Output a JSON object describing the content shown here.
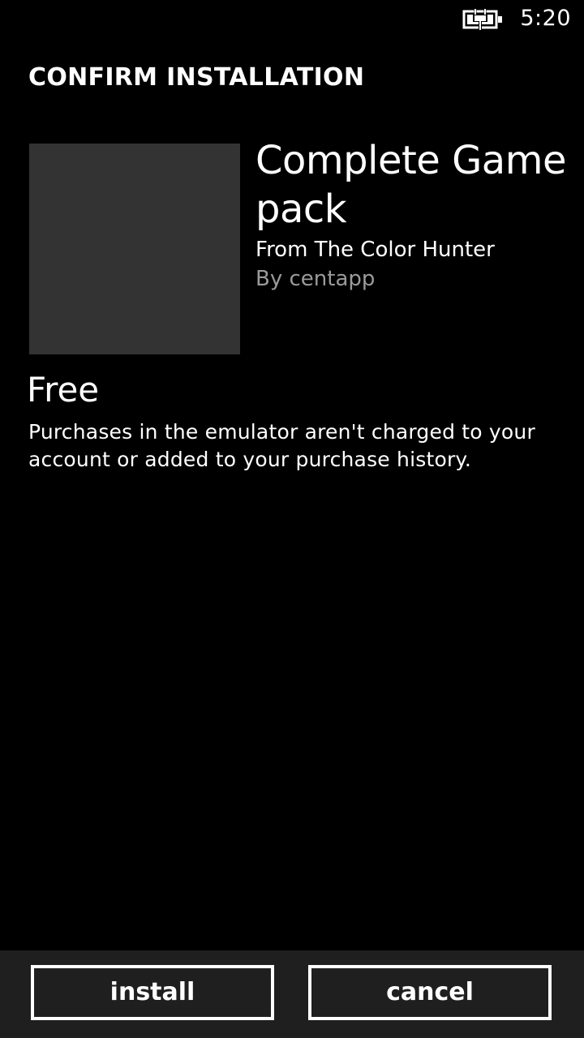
{
  "status_bar": {
    "time": "5:20",
    "battery_icon": "battery-charging-icon"
  },
  "page": {
    "title": "CONFIRM INSTALLATION"
  },
  "product": {
    "name": "Complete Game pack",
    "from": "From The Color Hunter",
    "publisher": "By centapp",
    "tile_color": "#333333"
  },
  "purchase": {
    "price": "Free",
    "note": "Purchases in the emulator aren't charged to your account or added to your purchase history."
  },
  "actions": {
    "install_label": "install",
    "cancel_label": "cancel"
  },
  "colors": {
    "background": "#000000",
    "app_bar": "#1f1f1f",
    "secondary_text": "#9a9a9a"
  }
}
